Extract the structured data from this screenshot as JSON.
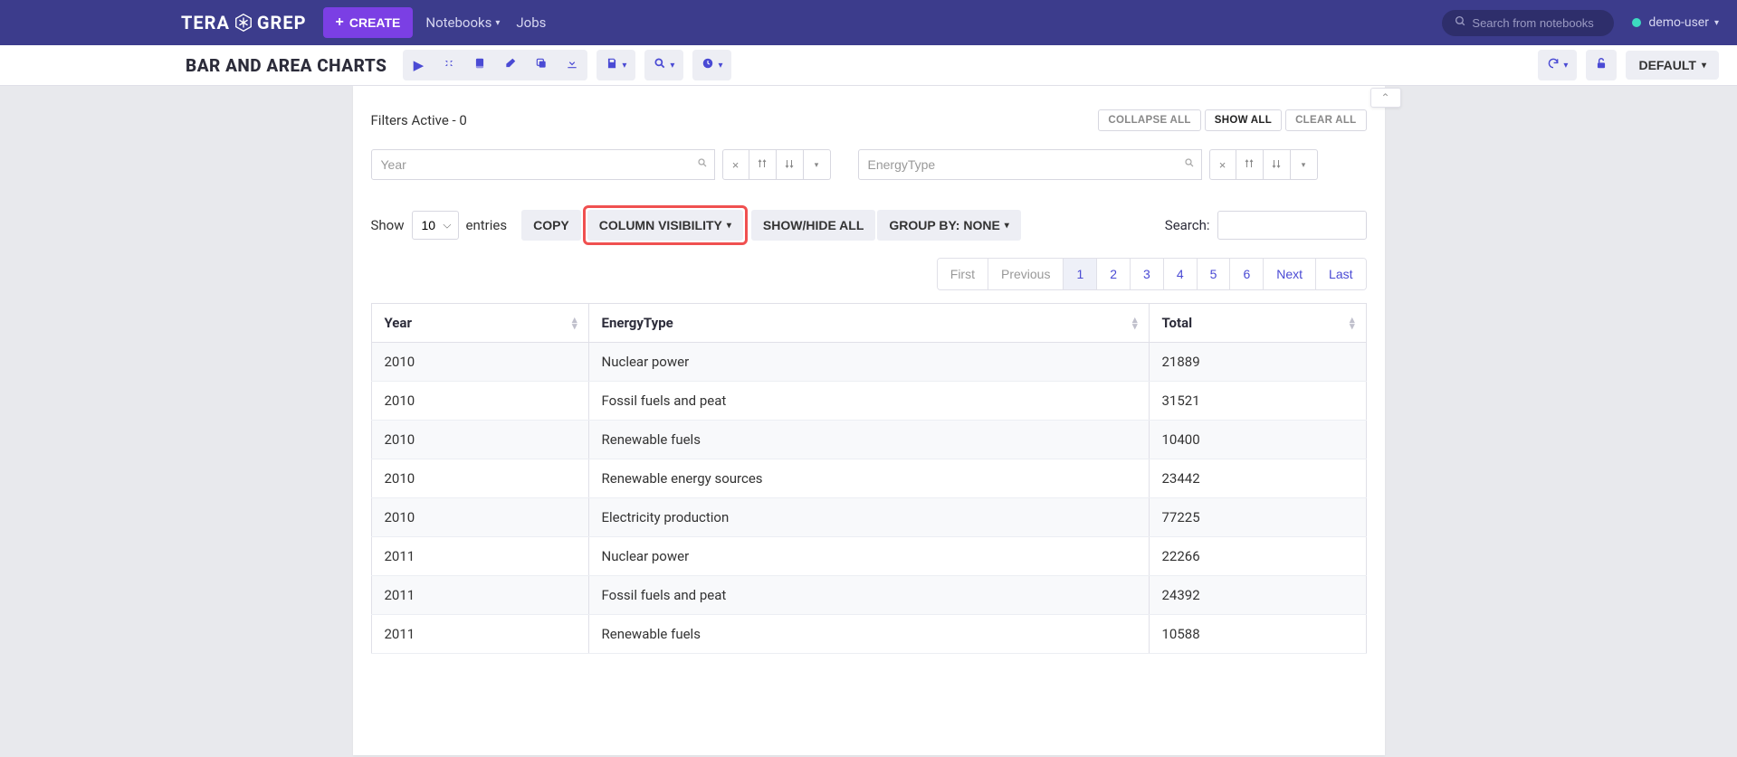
{
  "topbar": {
    "logo_left": "TERA",
    "logo_right": "GREP",
    "create_label": "CREATE",
    "nav_notebooks": "Notebooks",
    "nav_jobs": "Jobs",
    "search_placeholder": "Search from notebooks",
    "user_name": "demo-user"
  },
  "toolbar": {
    "title": "BAR AND AREA CHARTS",
    "default_label": "DEFAULT"
  },
  "filters": {
    "active_text": "Filters Active - 0",
    "collapse_all": "COLLAPSE ALL",
    "show_all": "SHOW ALL",
    "clear_all": "CLEAR ALL",
    "input1_placeholder": "Year",
    "input2_placeholder": "EnergyType"
  },
  "table_controls": {
    "show_label": "Show",
    "entries_label": "entries",
    "entries_value": "10",
    "copy": "COPY",
    "col_vis": "COLUMN VISIBILITY",
    "showhide": "SHOW/HIDE ALL",
    "groupby": "GROUP BY: NONE",
    "search_label": "Search:"
  },
  "pagination": {
    "first": "First",
    "previous": "Previous",
    "pages": [
      "1",
      "2",
      "3",
      "4",
      "5",
      "6"
    ],
    "next": "Next",
    "last": "Last"
  },
  "table": {
    "headers": {
      "year": "Year",
      "energy": "EnergyType",
      "total": "Total"
    },
    "rows": [
      {
        "year": "2010",
        "energy": "Nuclear power",
        "total": "21889"
      },
      {
        "year": "2010",
        "energy": "Fossil fuels and peat",
        "total": "31521"
      },
      {
        "year": "2010",
        "energy": "Renewable fuels",
        "total": "10400"
      },
      {
        "year": "2010",
        "energy": "Renewable energy sources",
        "total": "23442"
      },
      {
        "year": "2010",
        "energy": "Electricity production",
        "total": "77225"
      },
      {
        "year": "2011",
        "energy": "Nuclear power",
        "total": "22266"
      },
      {
        "year": "2011",
        "energy": "Fossil fuels and peat",
        "total": "24392"
      },
      {
        "year": "2011",
        "energy": "Renewable fuels",
        "total": "10588"
      }
    ]
  }
}
